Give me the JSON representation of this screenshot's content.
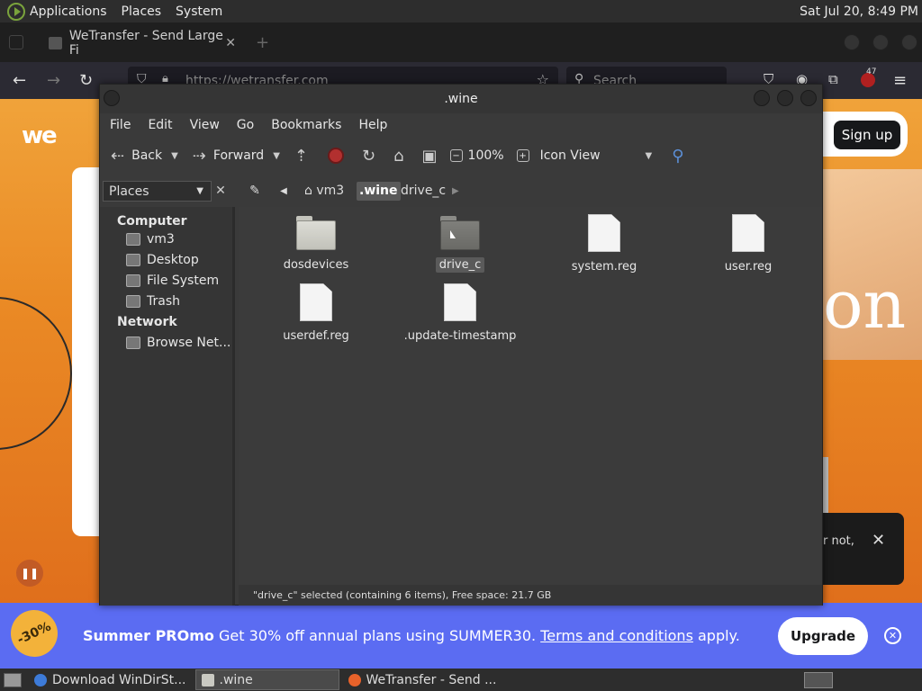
{
  "top_panel": {
    "menus": [
      "Applications",
      "Places",
      "System"
    ],
    "clock": "Sat Jul 20,  8:49 PM"
  },
  "browser": {
    "tab_title": "WeTransfer - Send Large Fi",
    "url": "https://wetransfer.com",
    "search_placeholder": "Search",
    "notification_count": "47"
  },
  "website": {
    "logo": "we",
    "signup_label": "Sign up",
    "hero_text": "on",
    "cookie_text": "r not,",
    "promo": {
      "badge": "-30%",
      "title": "Summer PROmo",
      "text": " Get 30% off annual plans using SUMMER30. ",
      "link": "Terms and conditions",
      "suffix": " apply.",
      "upgrade_label": "Upgrade"
    }
  },
  "file_manager": {
    "title": ".wine",
    "menus": [
      "File",
      "Edit",
      "View",
      "Go",
      "Bookmarks",
      "Help"
    ],
    "toolbar": {
      "back": "Back",
      "forward": "Forward",
      "zoom": "100%",
      "view_mode": "Icon View"
    },
    "sidebar_combo": "Places",
    "breadcrumbs": [
      "vm3",
      ".wine",
      "drive_c"
    ],
    "sidebar": {
      "computer_header": "Computer",
      "computer_items": [
        "vm3",
        "Desktop",
        "File System",
        "Trash"
      ],
      "network_header": "Network",
      "network_items": [
        "Browse Net..."
      ]
    },
    "files": [
      {
        "name": "dosdevices",
        "type": "folder"
      },
      {
        "name": "drive_c",
        "type": "folder",
        "selected": true
      },
      {
        "name": "system.reg",
        "type": "file"
      },
      {
        "name": "user.reg",
        "type": "file"
      },
      {
        "name": "userdef.reg",
        "type": "file"
      },
      {
        "name": ".update-timestamp",
        "type": "file"
      }
    ],
    "status": "\"drive_c\" selected (containing 6 items), Free space: 21.7 GB"
  },
  "taskbar": {
    "tasks": [
      "Download WinDirSt...",
      ".wine",
      "WeTransfer - Send ..."
    ]
  }
}
